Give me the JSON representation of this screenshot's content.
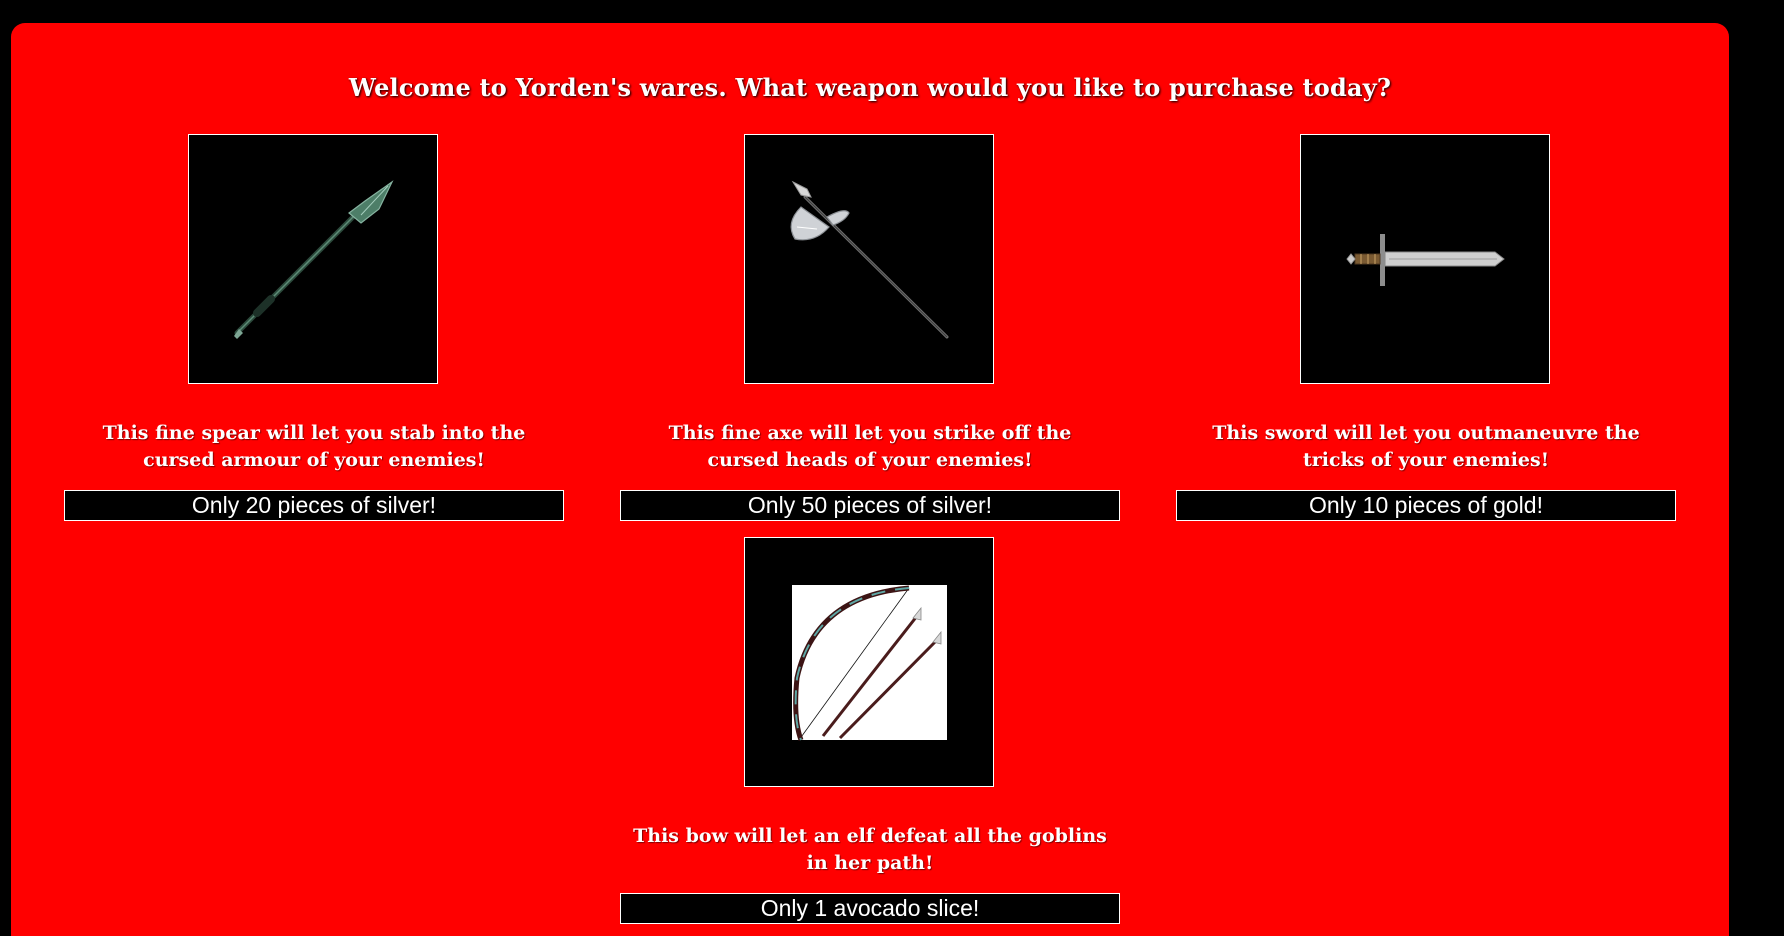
{
  "page": {
    "heading": "Welcome to Yorden's wares. What weapon would you like to purchase today?"
  },
  "colors": {
    "background": "#000000",
    "panel": "#ff0000",
    "text": "#ffffff",
    "price_box": "#000000"
  },
  "items": [
    {
      "icon": "spear-icon",
      "description": "This fine spear will let you stab into the cursed armour of your enemies!",
      "price": "Only 20 pieces of silver!"
    },
    {
      "icon": "axe-icon",
      "description": "This fine axe will let you strike off the cursed heads of your enemies!",
      "price": "Only 50 pieces of silver!"
    },
    {
      "icon": "sword-icon",
      "description": "This sword will let you outmaneuvre the tricks of your enemies!",
      "price": "Only 10 pieces of gold!"
    },
    {
      "icon": "bow-icon",
      "description": "This bow will let an elf defeat all the goblins in her path!",
      "price": "Only 1 avocado slice!"
    }
  ]
}
